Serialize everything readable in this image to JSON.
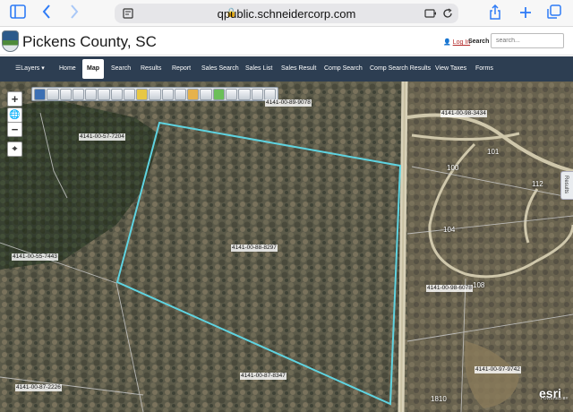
{
  "browser": {
    "url": "qpublic.schneidercorp.com",
    "icons": {
      "sidebar": "sidebar-icon",
      "back": "chevron-left-icon",
      "forward": "chevron-right-icon",
      "reader": "reader-icon",
      "share": "share-icon",
      "new_tab": "plus-icon",
      "tabs": "tabs-icon"
    }
  },
  "site": {
    "title": "Pickens County, SC",
    "login": "Log In",
    "search_label": "Search",
    "search_placeholder": "search..."
  },
  "nav": {
    "items": [
      {
        "label": "Layers"
      },
      {
        "label": "Home"
      },
      {
        "label": "Map"
      },
      {
        "label": "Search"
      },
      {
        "label": "Results"
      },
      {
        "label": "Report"
      },
      {
        "label": "Sales Search"
      },
      {
        "label": "Sales List"
      },
      {
        "label": "Sales Result"
      },
      {
        "label": "Comp Search"
      },
      {
        "label": "Comp Search Results"
      },
      {
        "label": "View Taxes"
      },
      {
        "label": "Forms"
      }
    ],
    "active": "Map"
  },
  "map": {
    "results_tab": "Results",
    "parcel_labels": [
      "4141-00-89-9078",
      "4141-00-57-7204",
      "4141-00-55-7443",
      "4141-00-88-8297",
      "4141-00-87-2226",
      "4141-00-87-8347",
      "4141-00-97-9742",
      "4141-00-98-6078",
      "4141-00-98-3434"
    ],
    "address_numbers": [
      "100",
      "101",
      "104",
      "108",
      "112",
      "1810"
    ],
    "esri": "esri",
    "powered_by": "POWERED BY",
    "highlight_color": "#5fd3e0"
  }
}
